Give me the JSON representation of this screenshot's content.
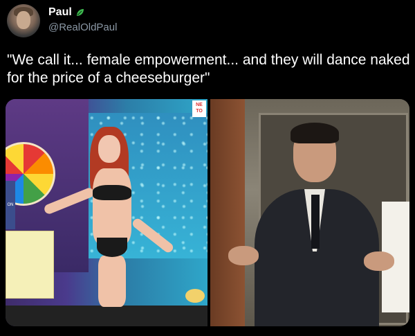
{
  "tweet": {
    "display_name": "Paul",
    "handle": "@RealOldPaul",
    "text": "\"We call it... female empowerment... and they will dance naked for the price of a cheeseburger\"",
    "badge_icon": "verified-leaf-icon",
    "colors": {
      "background": "#000000",
      "text": "#ffffff",
      "secondary_text": "#8b98a5",
      "badge": "#3fb950"
    }
  },
  "media": {
    "left_panel": {
      "overlay_labels": {
        "top_right": "NE\nTO",
        "side_tab": "ON"
      }
    },
    "right_panel": {}
  }
}
